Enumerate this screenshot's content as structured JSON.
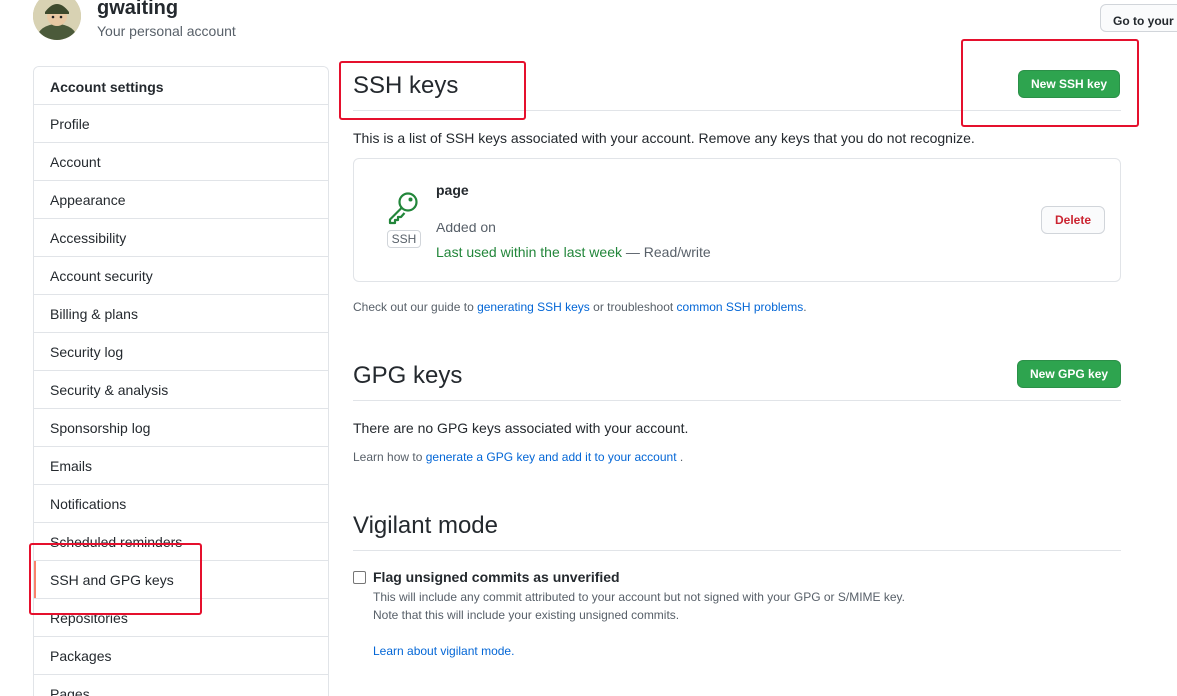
{
  "header": {
    "username": "gwaiting",
    "subtitle": "Your personal account",
    "profile_button": "Go to your personal profile"
  },
  "sidebar": {
    "title": "Account settings",
    "items": [
      {
        "label": "Profile"
      },
      {
        "label": "Account"
      },
      {
        "label": "Appearance"
      },
      {
        "label": "Accessibility"
      },
      {
        "label": "Account security"
      },
      {
        "label": "Billing & plans"
      },
      {
        "label": "Security log"
      },
      {
        "label": "Security & analysis"
      },
      {
        "label": "Sponsorship log"
      },
      {
        "label": "Emails"
      },
      {
        "label": "Notifications"
      },
      {
        "label": "Scheduled reminders"
      },
      {
        "label": "SSH and GPG keys"
      },
      {
        "label": "Repositories"
      },
      {
        "label": "Packages"
      },
      {
        "label": "Pages"
      }
    ],
    "selected": "SSH and GPG keys"
  },
  "ssh": {
    "title": "SSH keys",
    "new_button": "New SSH key",
    "description": "This is a list of SSH keys associated with your account. Remove any keys that you do not recognize.",
    "key": {
      "title": "page",
      "badge": "SSH",
      "added": "Added on",
      "last_used": "Last used within the last week",
      "access": " — Read/write",
      "delete_button": "Delete"
    },
    "guide_prefix": "Check out our guide to ",
    "guide_link1": "generating SSH keys",
    "guide_mid": " or troubleshoot ",
    "guide_link2": "common SSH problems",
    "guide_suffix": "."
  },
  "gpg": {
    "title": "GPG keys",
    "new_button": "New GPG key",
    "empty": "There are no GPG keys associated with your account.",
    "learn_prefix": "Learn how to ",
    "learn_link": "generate a GPG key and add it to your account",
    "learn_suffix": " ."
  },
  "vigilant": {
    "title": "Vigilant mode",
    "checkbox_label": "Flag unsigned commits as unverified",
    "note1": "This will include any commit attributed to your account but not signed with your GPG or S/MIME key.",
    "note2": "Note that this will include your existing unsigned commits.",
    "learn_link": "Learn about vigilant mode."
  },
  "colors": {
    "accent_green": "#2ea44f",
    "annotation_red": "#e5102d",
    "link_blue": "#0366d6"
  }
}
